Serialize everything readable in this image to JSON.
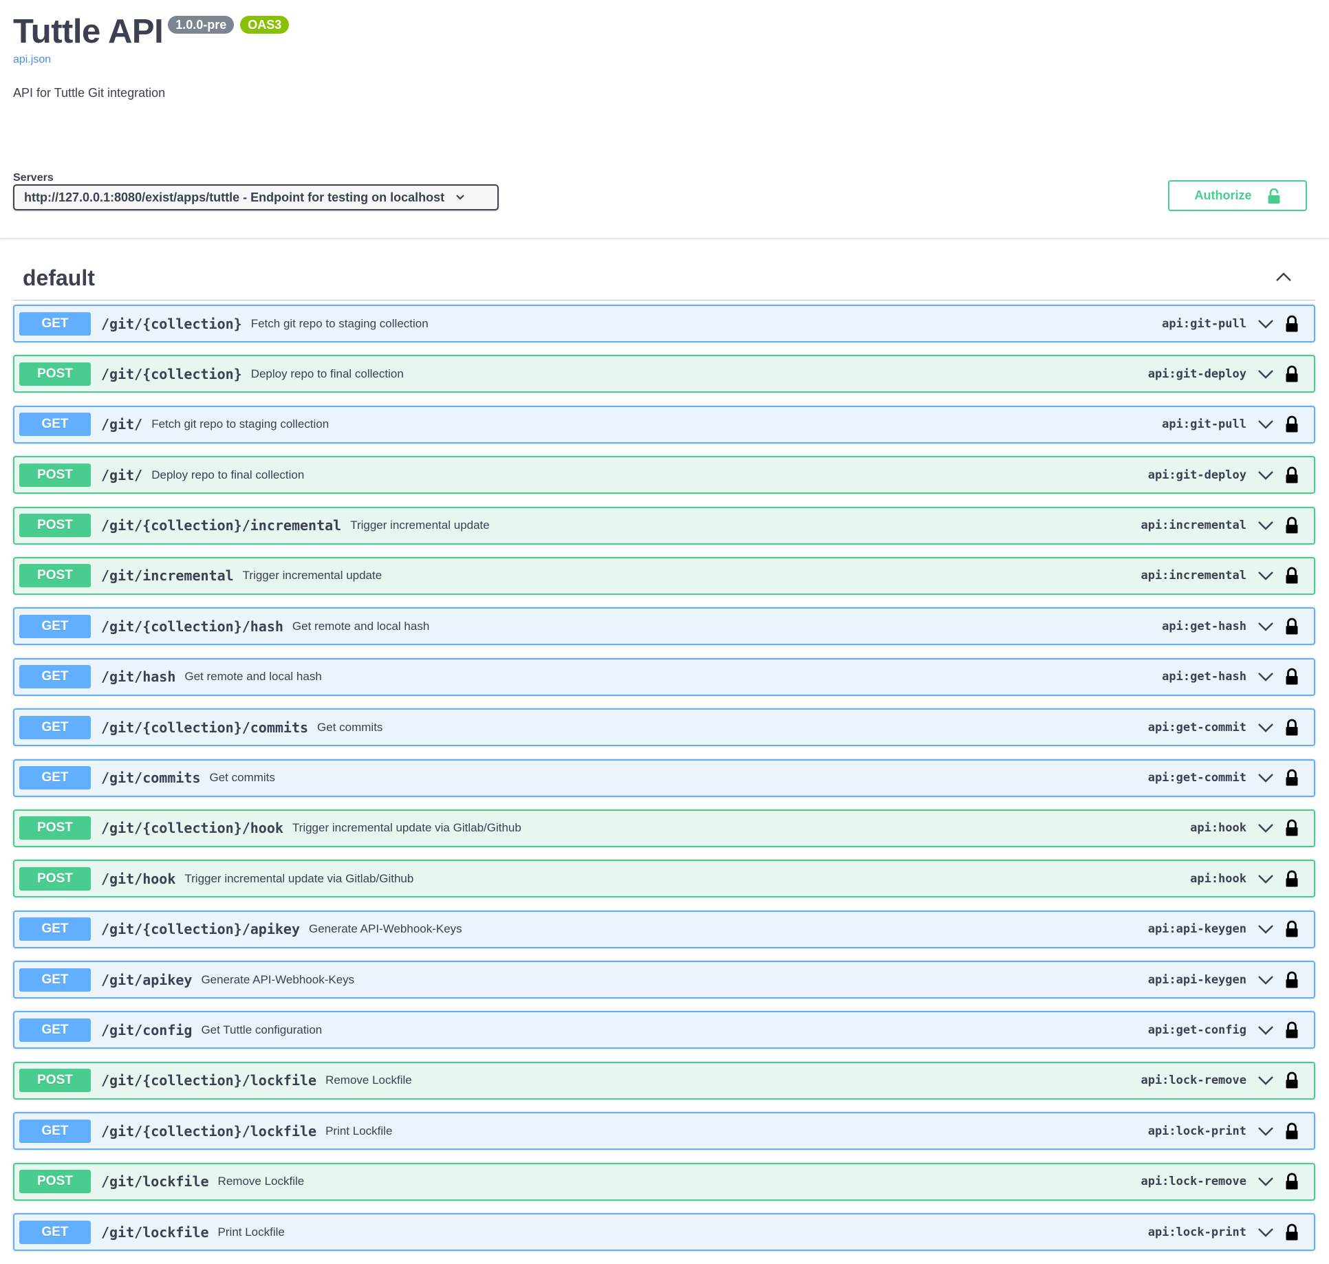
{
  "info": {
    "title": "Tuttle API",
    "version": "1.0.0-pre",
    "oas_badge": "OAS3",
    "spec_link": "api.json",
    "description": "API for Tuttle Git integration"
  },
  "servers": {
    "label": "Servers",
    "selected": "http://127.0.0.1:8080/exist/apps/tuttle - Endpoint for testing on localhost"
  },
  "authorize": {
    "label": "Authorize"
  },
  "tag": {
    "name": "default",
    "expanded": true
  },
  "colors": {
    "get": "#61affe",
    "post": "#49cc90",
    "text": "#3b4151",
    "link": "#4990e2",
    "version_badge": "#7d8492",
    "oas_badge": "#89bf04"
  },
  "operations": [
    {
      "method": "GET",
      "path": "/git/{collection}",
      "summary": "Fetch git repo to staging collection",
      "operation_id": "api:git-pull"
    },
    {
      "method": "POST",
      "path": "/git/{collection}",
      "summary": "Deploy repo to final collection",
      "operation_id": "api:git-deploy"
    },
    {
      "method": "GET",
      "path": "/git/",
      "summary": "Fetch git repo to staging collection",
      "operation_id": "api:git-pull"
    },
    {
      "method": "POST",
      "path": "/git/",
      "summary": "Deploy repo to final collection",
      "operation_id": "api:git-deploy"
    },
    {
      "method": "POST",
      "path": "/git/{collection}/incremental",
      "summary": "Trigger incremental update",
      "operation_id": "api:incremental"
    },
    {
      "method": "POST",
      "path": "/git/incremental",
      "summary": "Trigger incremental update",
      "operation_id": "api:incremental"
    },
    {
      "method": "GET",
      "path": "/git/{collection}/hash",
      "summary": "Get remote and local hash",
      "operation_id": "api:get-hash"
    },
    {
      "method": "GET",
      "path": "/git/hash",
      "summary": "Get remote and local hash",
      "operation_id": "api:get-hash"
    },
    {
      "method": "GET",
      "path": "/git/{collection}/commits",
      "summary": "Get commits",
      "operation_id": "api:get-commit"
    },
    {
      "method": "GET",
      "path": "/git/commits",
      "summary": "Get commits",
      "operation_id": "api:get-commit"
    },
    {
      "method": "POST",
      "path": "/git/{collection}/hook",
      "summary": "Trigger incremental update via Gitlab/Github",
      "operation_id": "api:hook"
    },
    {
      "method": "POST",
      "path": "/git/hook",
      "summary": "Trigger incremental update via Gitlab/Github",
      "operation_id": "api:hook"
    },
    {
      "method": "GET",
      "path": "/git/{collection}/apikey",
      "summary": "Generate API-Webhook-Keys",
      "operation_id": "api:api-keygen"
    },
    {
      "method": "GET",
      "path": "/git/apikey",
      "summary": "Generate API-Webhook-Keys",
      "operation_id": "api:api-keygen"
    },
    {
      "method": "GET",
      "path": "/git/config",
      "summary": "Get Tuttle configuration",
      "operation_id": "api:get-config"
    },
    {
      "method": "POST",
      "path": "/git/{collection}/lockfile",
      "summary": "Remove Lockfile",
      "operation_id": "api:lock-remove"
    },
    {
      "method": "GET",
      "path": "/git/{collection}/lockfile",
      "summary": "Print Lockfile",
      "operation_id": "api:lock-print"
    },
    {
      "method": "POST",
      "path": "/git/lockfile",
      "summary": "Remove Lockfile",
      "operation_id": "api:lock-remove"
    },
    {
      "method": "GET",
      "path": "/git/lockfile",
      "summary": "Print Lockfile",
      "operation_id": "api:lock-print"
    }
  ]
}
